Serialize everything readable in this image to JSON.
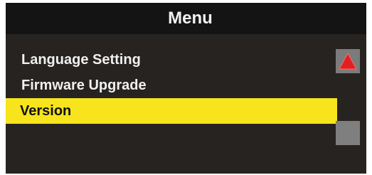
{
  "header": {
    "title": "Menu"
  },
  "menu": {
    "items": [
      {
        "label": "Language Setting",
        "selected": false
      },
      {
        "label": "Firmware Upgrade",
        "selected": false
      },
      {
        "label": "Version",
        "selected": true
      }
    ]
  },
  "scrollbar": {
    "up_icon": "triangle-up-icon",
    "up_icon_color": "#e02020"
  },
  "colors": {
    "highlight": "#f7e41c",
    "background": "#262321",
    "title_bar": "#141414"
  }
}
